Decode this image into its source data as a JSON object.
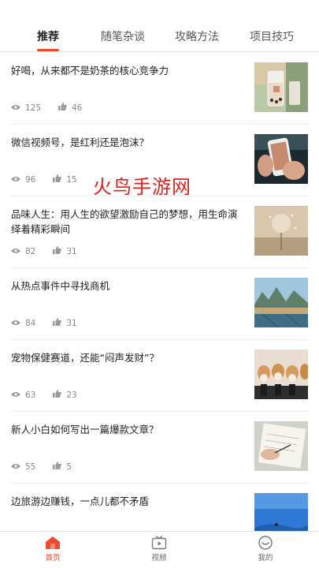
{
  "tabs": [
    {
      "label": "推荐",
      "active": true
    },
    {
      "label": "随笔杂谈",
      "active": false
    },
    {
      "label": "攻略方法",
      "active": false
    },
    {
      "label": "项目技巧",
      "active": false
    }
  ],
  "articles": [
    {
      "title": "好喝，从来都不是奶茶的核心竞争力",
      "views": "125",
      "likes": "46",
      "thumb": "milk-tea-photo"
    },
    {
      "title": "微信视频号，是红利还是泡沫？",
      "views": "96",
      "likes": "15",
      "thumb": "phone-photo"
    },
    {
      "title": "品味人生：用人生的欲望激励自己的梦想，用生命演绎着精彩瞬间",
      "views": "82",
      "likes": "31",
      "thumb": "dandelion-photo"
    },
    {
      "title": "从热点事件中寻找商机",
      "views": "84",
      "likes": "31",
      "thumb": "landscape-photo"
    },
    {
      "title": "宠物保健赛道，还能“闷声发财”？",
      "views": "63",
      "likes": "23",
      "thumb": "hamsters-photo"
    },
    {
      "title": "新人小白如何写出一篇爆款文章？",
      "views": "55",
      "likes": "5",
      "thumb": "writing-photo"
    },
    {
      "title": "边旅游边赚钱，一点儿都不矛盾",
      "views": "",
      "likes": "",
      "thumb": "sky-photo"
    }
  ],
  "watermark": "火鸟手游网",
  "bottom_nav": [
    {
      "label": "首页",
      "icon": "home-icon",
      "active": true
    },
    {
      "label": "视频",
      "icon": "video-icon",
      "active": false
    },
    {
      "label": "我的",
      "icon": "profile-icon",
      "active": false
    }
  ],
  "colors": {
    "accent": "#f04a2e",
    "watermark": "#e0211c"
  }
}
